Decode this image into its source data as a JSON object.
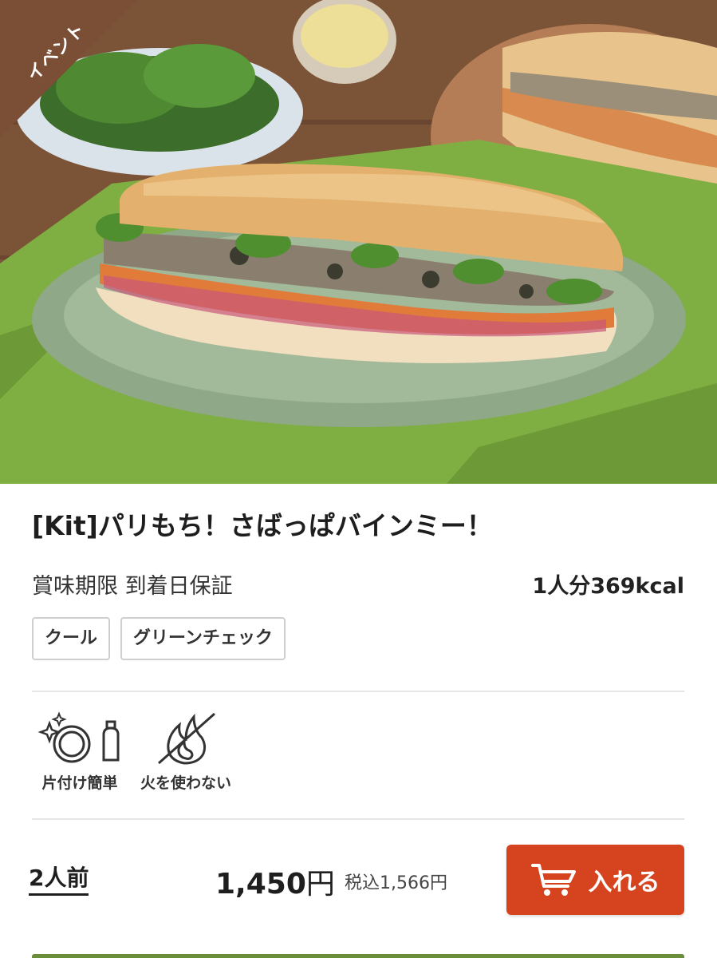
{
  "hero": {
    "image_alt": "さばっぱバインミー",
    "ribbon_label": "イベント"
  },
  "product": {
    "title": "[Kit]パリもち！さばっぱバインミー！",
    "expiry": "賞味期限 到着日保証",
    "kcal": "1人分369kcal",
    "tags": [
      "クール",
      "グリーンチェック"
    ]
  },
  "features": [
    {
      "icon": "easy-cleanup-icon",
      "label": "片付け簡単"
    },
    {
      "icon": "no-fire-icon",
      "label": "火を使わない"
    }
  ],
  "purchase": {
    "servings": "2人前",
    "price": "1,450",
    "price_unit": "円",
    "tax_included": "税込1,566円",
    "cart_button_label": "入れる",
    "cart_button_color": "#d6441f"
  },
  "colors": {
    "ribbon": "#7a4f36",
    "accent_bar": "#6b8e3a"
  }
}
